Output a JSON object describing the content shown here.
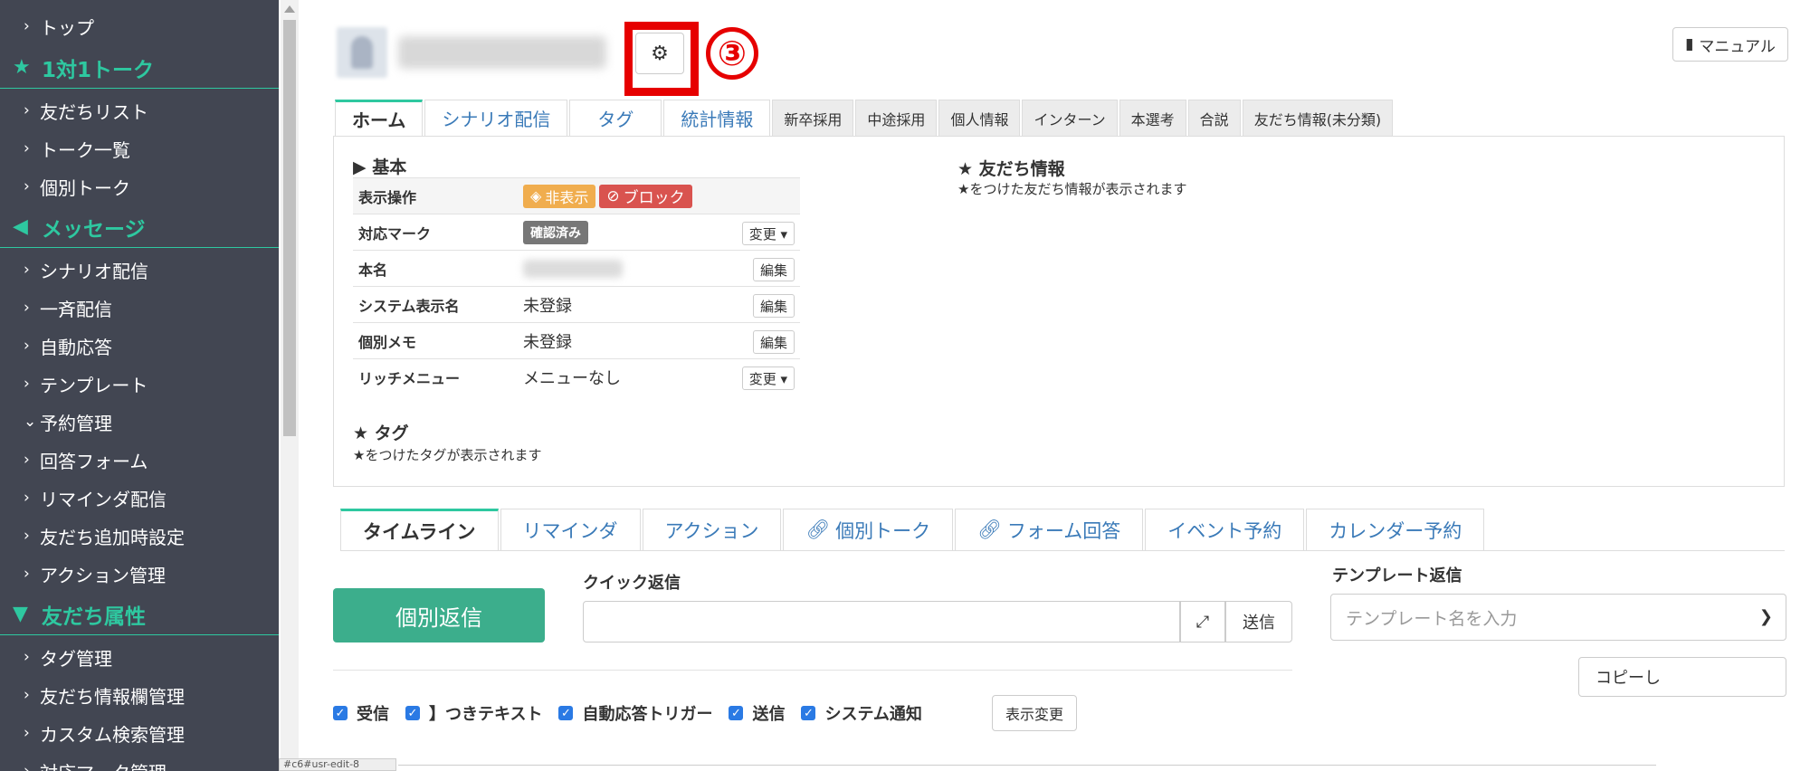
{
  "sidebar": {
    "items": [
      {
        "label": "トップ"
      },
      {
        "label": "友だちリスト"
      },
      {
        "label": "トーク一覧"
      },
      {
        "label": "個別トーク"
      },
      {
        "label": "シナリオ配信"
      },
      {
        "label": "一斉配信"
      },
      {
        "label": "自動応答"
      },
      {
        "label": "テンプレート"
      },
      {
        "label": "予約管理"
      },
      {
        "label": "回答フォーム"
      },
      {
        "label": "リマインダ配信"
      },
      {
        "label": "友だち追加時設定"
      },
      {
        "label": "アクション管理"
      },
      {
        "label": "タグ管理"
      },
      {
        "label": "友だち情報欄管理"
      },
      {
        "label": "カスタム検索管理"
      },
      {
        "label": "対応マーク管理"
      }
    ],
    "sections": [
      {
        "label": "1対1トーク",
        "icon": "star-icon"
      },
      {
        "label": "メッセージ",
        "icon": "megaphone-icon"
      },
      {
        "label": "友だち属性",
        "icon": "filter-icon"
      }
    ]
  },
  "header": {
    "step_number": "③",
    "manual_label": "マニュアル"
  },
  "top_tabs": [
    {
      "label": "ホーム"
    },
    {
      "label": "シナリオ配信"
    },
    {
      "label": "タグ"
    },
    {
      "label": "統計情報"
    },
    {
      "label": "新卒採用"
    },
    {
      "label": "中途採用"
    },
    {
      "label": "個人情報"
    },
    {
      "label": "インターン"
    },
    {
      "label": "本選考"
    },
    {
      "label": "合説"
    },
    {
      "label": "友だち情報(未分類)"
    }
  ],
  "basic": {
    "title": "▶ 基本",
    "rows": {
      "display_ops": {
        "label": "表示操作",
        "hide": "非表示",
        "block": "ブロック"
      },
      "mark": {
        "label": "対応マーク",
        "value": "確認済み",
        "button": "変更 ▾"
      },
      "real_name": {
        "label": "本名",
        "button": "編集"
      },
      "system_name": {
        "label": "システム表示名",
        "value": "未登録",
        "button": "編集"
      },
      "memo": {
        "label": "個別メモ",
        "value": "未登録",
        "button": "編集"
      },
      "rich_menu": {
        "label": "リッチメニュー",
        "value": "メニューなし",
        "button": "変更 ▾"
      }
    }
  },
  "tags": {
    "title": "★ タグ",
    "note": "★をつけたタグが表示されます"
  },
  "friend_info": {
    "title": "★ 友だち情報",
    "note": "★をつけた友だち情報が表示されます"
  },
  "low_tabs": [
    {
      "label": "タイムライン"
    },
    {
      "label": "リマインダ"
    },
    {
      "label": "アクション"
    },
    {
      "label": "個別トーク"
    },
    {
      "label": "フォーム回答"
    },
    {
      "label": "イベント予約"
    },
    {
      "label": "カレンダー予約"
    }
  ],
  "reply": {
    "button": "個別返信",
    "quick_label": "クイック返信",
    "quick_value": "",
    "send": "送信"
  },
  "template": {
    "label": "テンプレート返信",
    "placeholder": "テンプレート名を入力",
    "copy": "コピーし"
  },
  "filters": [
    {
      "label": "受信"
    },
    {
      "label": "】つきテキスト"
    },
    {
      "label": "自動応答トリガー"
    },
    {
      "label": "送信"
    },
    {
      "label": "システム通知"
    }
  ],
  "display_change": "表示変更",
  "status_url": "#c6#usr-edit-8"
}
